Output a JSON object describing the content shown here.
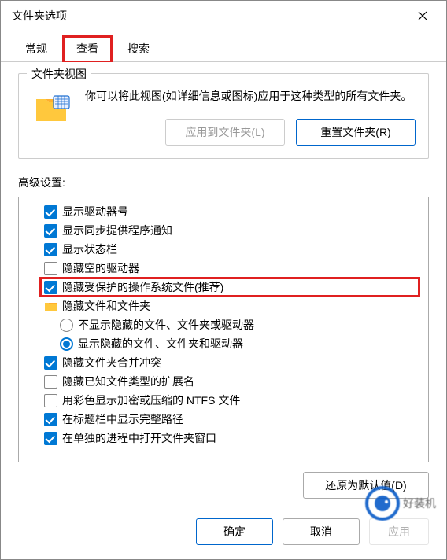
{
  "window": {
    "title": "文件夹选项"
  },
  "tabs": {
    "general": "常规",
    "view": "查看",
    "search": "搜索"
  },
  "folderViews": {
    "label": "文件夹视图",
    "description": "你可以将此视图(如详细信息或图标)应用于这种类型的所有文件夹。",
    "applyButton": "应用到文件夹(L)",
    "resetButton": "重置文件夹(R)"
  },
  "advanced": {
    "label": "高级设置:",
    "items": [
      {
        "type": "checkbox",
        "checked": true,
        "label": "显示驱动器号",
        "indent": 1
      },
      {
        "type": "checkbox",
        "checked": true,
        "label": "显示同步提供程序通知",
        "indent": 1
      },
      {
        "type": "checkbox",
        "checked": true,
        "label": "显示状态栏",
        "indent": 1
      },
      {
        "type": "checkbox",
        "checked": false,
        "label": "隐藏空的驱动器",
        "indent": 1
      },
      {
        "type": "checkbox",
        "checked": true,
        "label": "隐藏受保护的操作系统文件(推荐)",
        "indent": 1,
        "highlight": true
      },
      {
        "type": "folder",
        "label": "隐藏文件和文件夹",
        "indent": 1
      },
      {
        "type": "radio",
        "checked": false,
        "label": "不显示隐藏的文件、文件夹或驱动器",
        "indent": 2
      },
      {
        "type": "radio",
        "checked": true,
        "label": "显示隐藏的文件、文件夹和驱动器",
        "indent": 2
      },
      {
        "type": "checkbox",
        "checked": true,
        "label": "隐藏文件夹合并冲突",
        "indent": 1
      },
      {
        "type": "checkbox",
        "checked": false,
        "label": "隐藏已知文件类型的扩展名",
        "indent": 1
      },
      {
        "type": "checkbox",
        "checked": false,
        "label": "用彩色显示加密或压缩的 NTFS 文件",
        "indent": 1
      },
      {
        "type": "checkbox",
        "checked": true,
        "label": "在标题栏中显示完整路径",
        "indent": 1
      },
      {
        "type": "checkbox",
        "checked": true,
        "label": "在单独的进程中打开文件夹窗口",
        "indent": 1
      }
    ],
    "restoreButton": "还原为默认值(D)"
  },
  "footer": {
    "ok": "确定",
    "cancel": "取消",
    "apply": "应用"
  },
  "watermark": "好装机"
}
